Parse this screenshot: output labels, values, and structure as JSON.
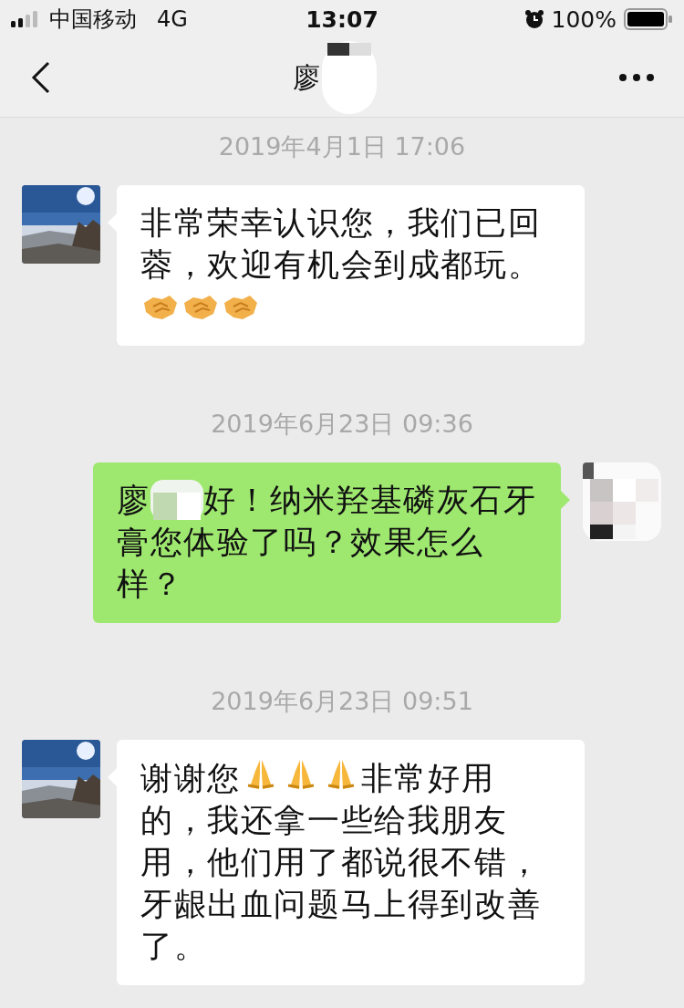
{
  "status_bar": {
    "carrier": "中国移动",
    "network": "4G",
    "time": "13:07",
    "battery": "100%"
  },
  "header": {
    "title": "廖"
  },
  "messages": [
    {
      "kind": "time",
      "text": "2019年4月1日 17:06"
    },
    {
      "kind": "incoming",
      "parts": [
        {
          "kind": "text",
          "text": "非常荣幸认识您，我们已回蓉，欢迎有机会到成都玩。"
        },
        {
          "kind": "break"
        },
        {
          "kind": "handshake"
        },
        {
          "kind": "handshake"
        },
        {
          "kind": "handshake"
        }
      ]
    },
    {
      "kind": "time",
      "text": "2019年6月23日 09:36"
    },
    {
      "kind": "outgoing",
      "parts": [
        {
          "kind": "text",
          "text": "廖"
        },
        {
          "kind": "mask"
        },
        {
          "kind": "text",
          "text": "好！纳米羟基磷灰石牙"
        },
        {
          "kind": "break"
        },
        {
          "kind": "text",
          "text": "膏您体验了吗？效果怎么样？"
        }
      ]
    },
    {
      "kind": "time",
      "text": "2019年6月23日 09:51"
    },
    {
      "kind": "incoming",
      "parts": [
        {
          "kind": "text",
          "text": "谢谢您"
        },
        {
          "kind": "pray"
        },
        {
          "kind": "pray"
        },
        {
          "kind": "pray"
        },
        {
          "kind": "text",
          "text": "非常好用"
        },
        {
          "kind": "break"
        },
        {
          "kind": "text",
          "text": "的，我还拿一些给我朋友用，他们用了都说很不错，牙龈出血问题马上得到改善了。"
        }
      ]
    }
  ]
}
